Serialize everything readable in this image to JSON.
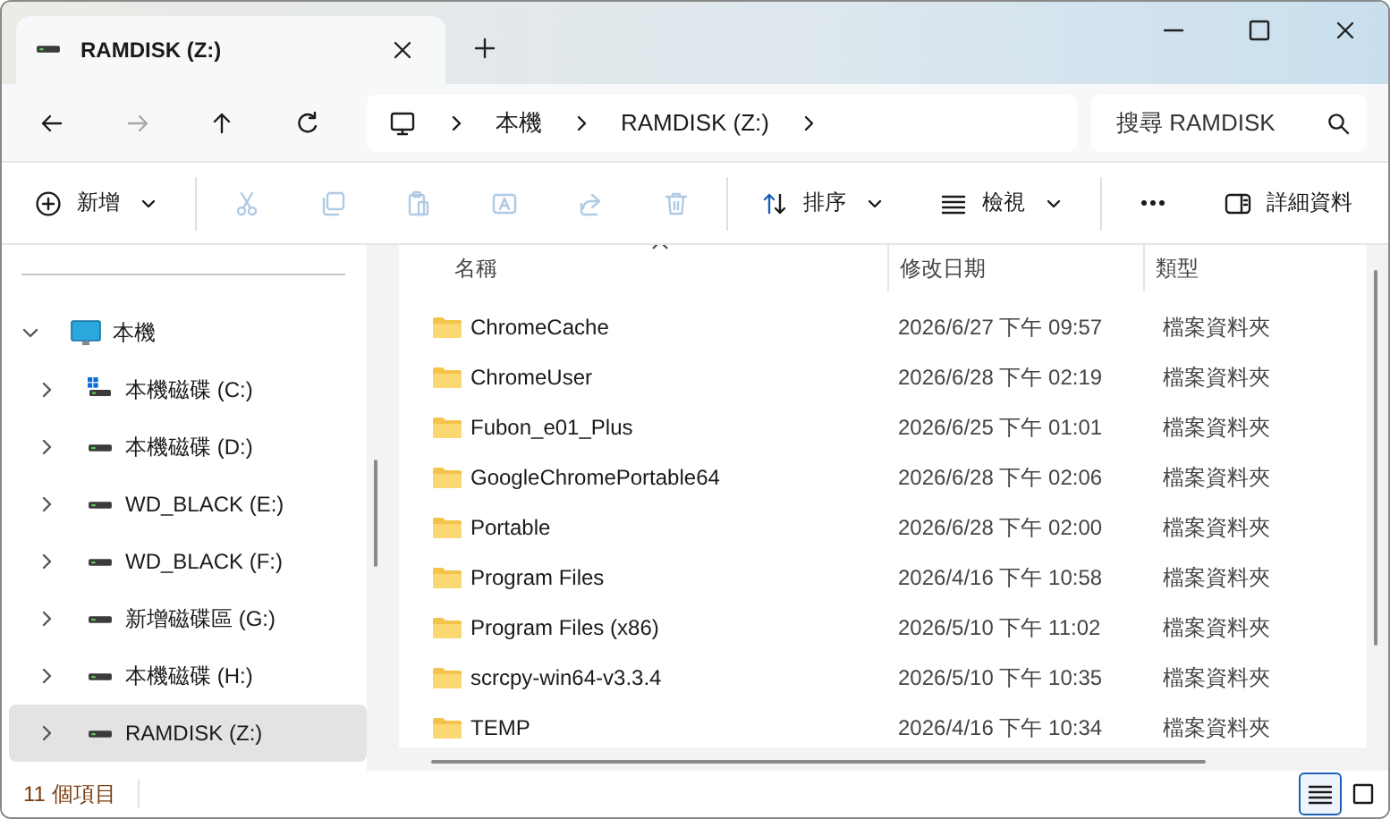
{
  "window": {
    "tab": {
      "title": "RAMDISK (Z:)"
    }
  },
  "nav": {
    "buttons": [
      {
        "kind": "back",
        "disabled": false
      },
      {
        "kind": "forward",
        "disabled": true
      },
      {
        "kind": "up",
        "disabled": false
      },
      {
        "kind": "refresh",
        "disabled": false
      }
    ],
    "breadcrumb": [
      "本機",
      "RAMDISK (Z:)"
    ],
    "search": {
      "placeholder": "搜尋 RAMDISK"
    }
  },
  "toolbar": {
    "groups": [
      [
        {
          "kind": "new",
          "label": "新增",
          "disabled": false
        }
      ],
      [
        {
          "kind": "cut",
          "disabled": true
        },
        {
          "kind": "copy",
          "disabled": true
        },
        {
          "kind": "paste",
          "disabled": true
        },
        {
          "kind": "rename",
          "disabled": true
        },
        {
          "kind": "share",
          "disabled": true
        },
        {
          "kind": "delete",
          "disabled": true
        }
      ],
      [
        {
          "kind": "sort",
          "label": "排序",
          "disabled": false
        },
        {
          "kind": "view",
          "label": "檢視",
          "disabled": false
        }
      ],
      [
        {
          "kind": "more",
          "disabled": false
        }
      ]
    ],
    "details": {
      "label": "詳細資料"
    }
  },
  "sidebar": {
    "tree": [
      {
        "label": "本機",
        "kind": "computer",
        "expanded": true,
        "selected": false,
        "children": [
          {
            "label": "本機磁碟 (C:)",
            "kind": "system-drive",
            "expanded": false,
            "selected": false
          },
          {
            "label": "本機磁碟 (D:)",
            "kind": "drive",
            "expanded": false,
            "selected": false
          },
          {
            "label": "WD_BLACK (E:)",
            "kind": "drive",
            "expanded": false,
            "selected": false
          },
          {
            "label": "WD_BLACK (F:)",
            "kind": "drive",
            "expanded": false,
            "selected": false
          },
          {
            "label": "新增磁碟區 (G:)",
            "kind": "drive",
            "expanded": false,
            "selected": false
          },
          {
            "label": "本機磁碟 (H:)",
            "kind": "drive",
            "expanded": false,
            "selected": false
          },
          {
            "label": "RAMDISK (Z:)",
            "kind": "drive",
            "expanded": false,
            "selected": true
          }
        ]
      }
    ]
  },
  "file_list": {
    "columns": [
      {
        "label": "名稱",
        "sorted": true
      },
      {
        "label": "修改日期",
        "sorted": false
      },
      {
        "label": "類型",
        "sorted": false
      }
    ],
    "rows": [
      {
        "name": "ChromeCache",
        "modified": "2026/6/27 下午 09:57",
        "type": "檔案資料夾"
      },
      {
        "name": "ChromeUser",
        "modified": "2026/6/28 下午 02:19",
        "type": "檔案資料夾"
      },
      {
        "name": "Fubon_e01_Plus",
        "modified": "2026/6/25 下午 01:01",
        "type": "檔案資料夾"
      },
      {
        "name": "GoogleChromePortable64",
        "modified": "2026/6/28 下午 02:06",
        "type": "檔案資料夾"
      },
      {
        "name": "Portable",
        "modified": "2026/6/28 下午 02:00",
        "type": "檔案資料夾"
      },
      {
        "name": "Program Files",
        "modified": "2026/4/16 下午 10:58",
        "type": "檔案資料夾"
      },
      {
        "name": "Program Files (x86)",
        "modified": "2026/5/10 下午 11:02",
        "type": "檔案資料夾"
      },
      {
        "name": "scrcpy-win64-v3.3.4",
        "modified": "2026/5/10 下午 10:35",
        "type": "檔案資料夾"
      },
      {
        "name": "TEMP",
        "modified": "2026/4/16 下午 10:34",
        "type": "檔案資料夾"
      }
    ]
  },
  "status_bar": {
    "item_count": "11 個項目",
    "views": [
      {
        "kind": "details",
        "selected": true
      },
      {
        "kind": "tiles",
        "selected": false
      }
    ]
  }
}
